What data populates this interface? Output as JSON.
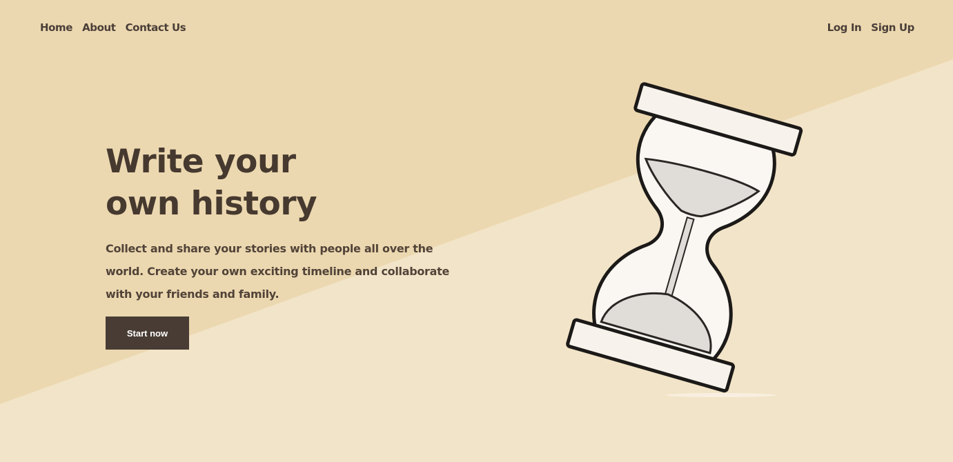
{
  "nav": {
    "left": [
      {
        "label": "Home"
      },
      {
        "label": "About"
      },
      {
        "label": "Contact Us"
      }
    ],
    "right": [
      {
        "label": "Log In"
      },
      {
        "label": "Sign Up"
      }
    ]
  },
  "hero": {
    "title": "Write your own history",
    "description": "Collect and share your stories with people all over the world. Create your own exciting timeline and collaborate with your friends and family.",
    "cta_label": "Start now"
  },
  "illustration": {
    "icon": "hourglass-icon"
  },
  "colors": {
    "background_light": "#f2e4c8",
    "background_dark": "#ecd8b0",
    "text": "#46392f",
    "button": "#483c35"
  }
}
